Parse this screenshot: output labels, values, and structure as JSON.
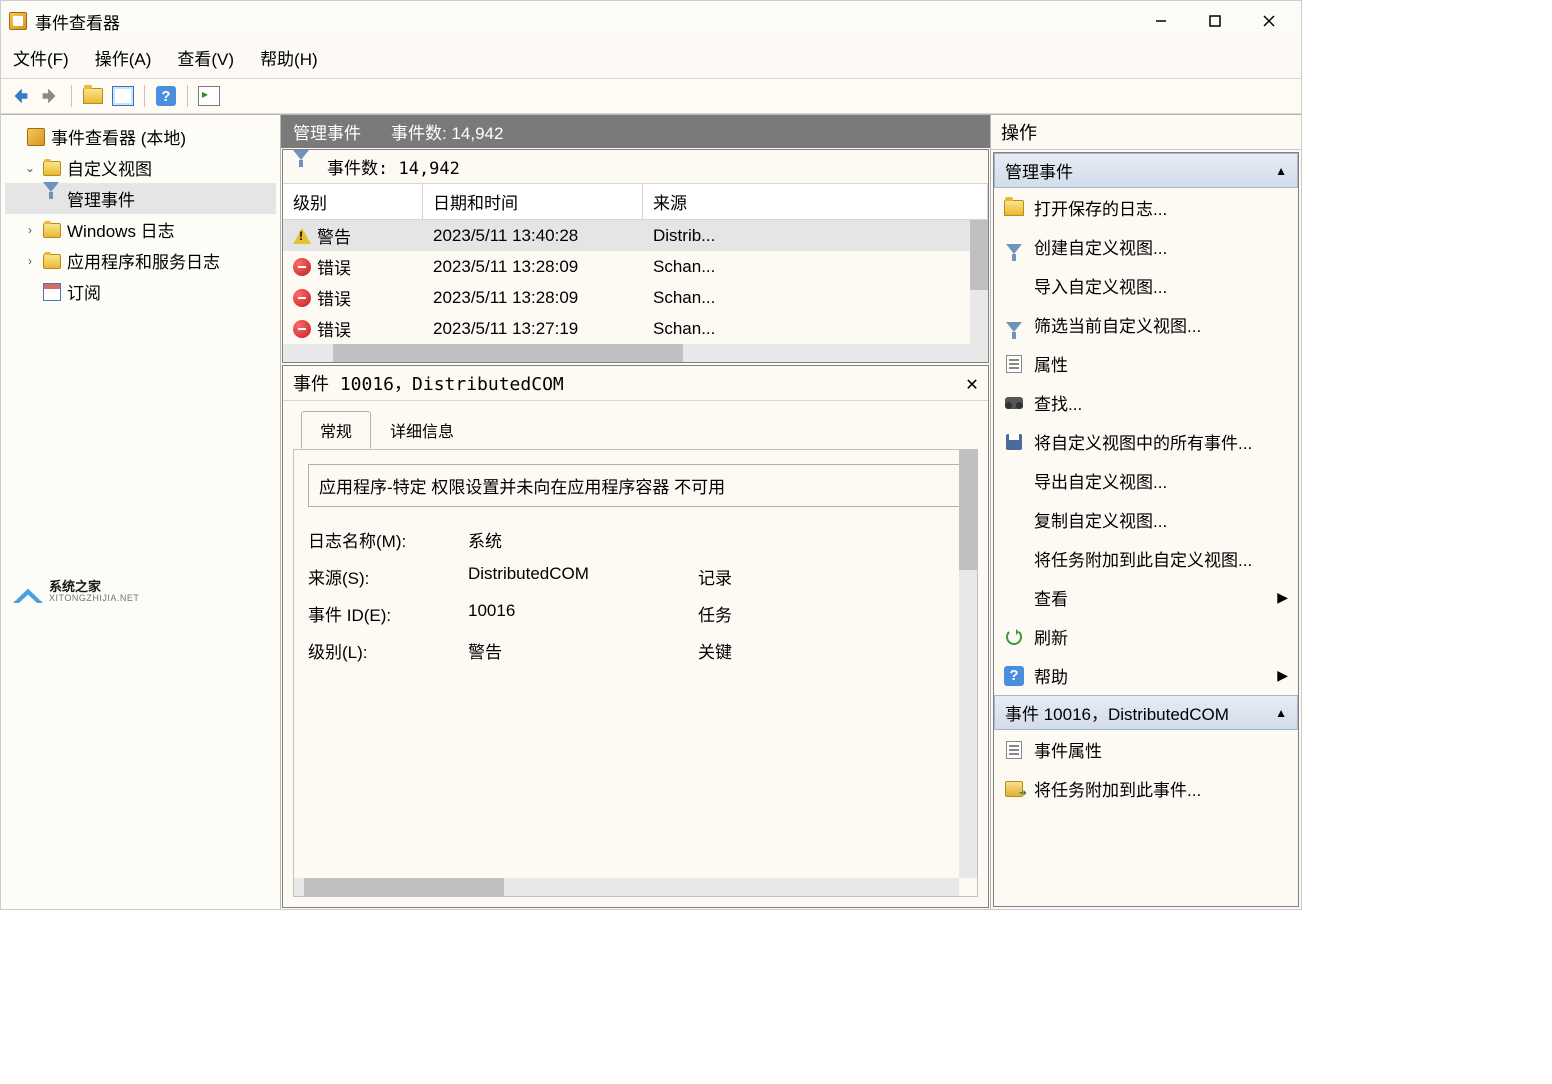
{
  "window": {
    "title": "事件查看器"
  },
  "menu": {
    "file": "文件(F)",
    "action": "操作(A)",
    "view": "查看(V)",
    "help": "帮助(H)"
  },
  "tree": {
    "root": "事件查看器 (本地)",
    "custom": "自定义视图",
    "admin": "管理事件",
    "winlogs": "Windows 日志",
    "applogs": "应用程序和服务日志",
    "subscribe": "订阅"
  },
  "watermark": {
    "name": "系统之家",
    "url": "XITONGZHIJIA.NET"
  },
  "midheader": {
    "name": "管理事件",
    "count_label": "事件数: 14,942"
  },
  "filterbar": {
    "count": "事件数: 14,942"
  },
  "columns": {
    "level": "级别",
    "datetime": "日期和时间",
    "source": "来源"
  },
  "events": [
    {
      "level": "警告",
      "datetime": "2023/5/11 13:40:28",
      "source": "Distrib...",
      "type": "warn"
    },
    {
      "level": "错误",
      "datetime": "2023/5/11 13:28:09",
      "source": "Schan...",
      "type": "err"
    },
    {
      "level": "错误",
      "datetime": "2023/5/11 13:28:09",
      "source": "Schan...",
      "type": "err"
    },
    {
      "level": "错误",
      "datetime": "2023/5/11 13:27:19",
      "source": "Schan...",
      "type": "err"
    }
  ],
  "detail": {
    "title": "事件 10016，DistributedCOM",
    "tab_general": "常规",
    "tab_details": "详细信息",
    "message": "应用程序-特定 权限设置并未向在应用程序容器 不可用",
    "props": {
      "logname_l": "日志名称(M):",
      "logname_v": "系统",
      "source_l": "来源(S):",
      "source_v": "DistributedCOM",
      "source_r": "记录",
      "eventid_l": "事件 ID(E):",
      "eventid_v": "10016",
      "eventid_r": "任务",
      "level_l": "级别(L):",
      "level_v": "警告",
      "level_r": "关键"
    }
  },
  "actions": {
    "title": "操作",
    "sec1": "管理事件",
    "items1": [
      "打开保存的日志...",
      "创建自定义视图...",
      "导入自定义视图...",
      "筛选当前自定义视图...",
      "属性",
      "查找...",
      "将自定义视图中的所有事件...",
      "导出自定义视图...",
      "复制自定义视图...",
      "将任务附加到此自定义视图...",
      "查看",
      "刷新",
      "帮助"
    ],
    "sec2": "事件 10016，DistributedCOM",
    "items2": [
      "事件属性",
      "将任务附加到此事件..."
    ]
  }
}
